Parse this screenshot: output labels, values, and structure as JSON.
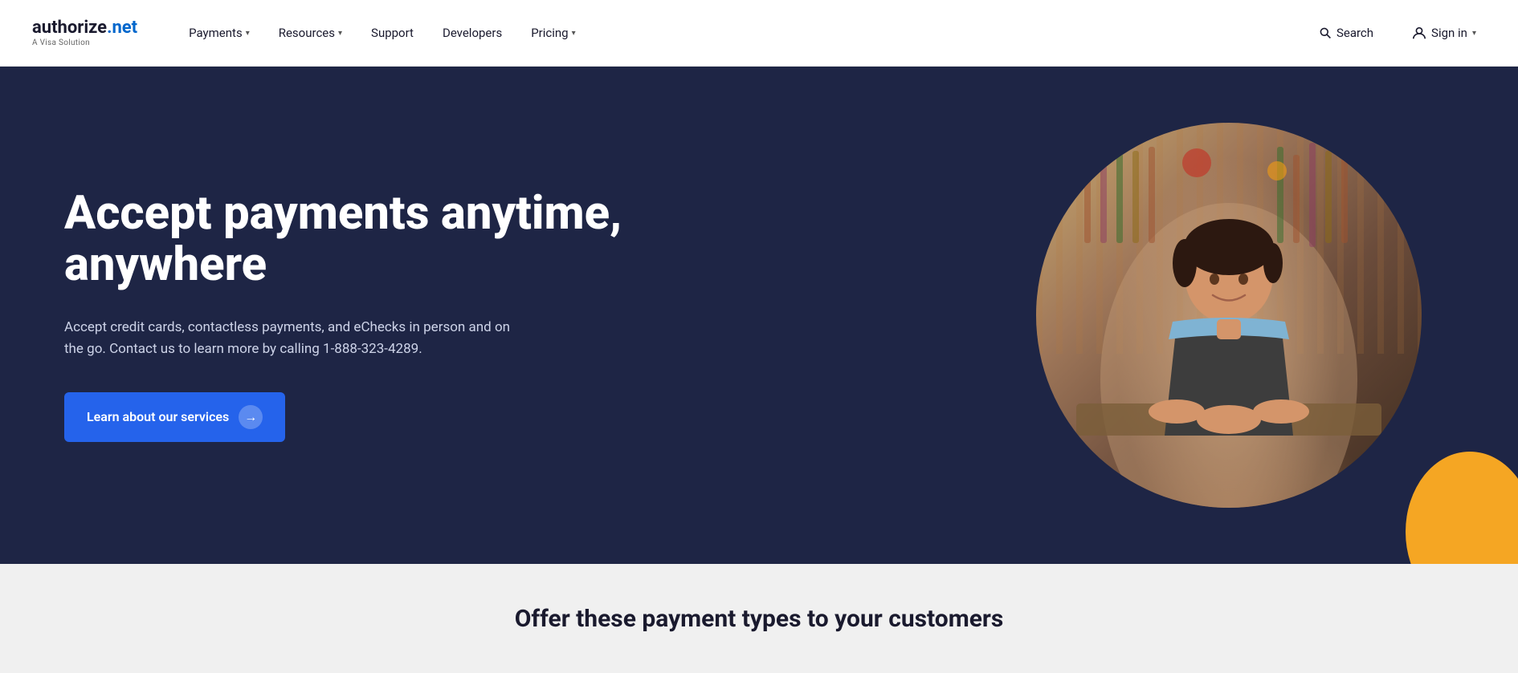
{
  "logo": {
    "brand": "authorize",
    "brand_dot": ".",
    "brand_net": "net",
    "tagline": "A Visa Solution"
  },
  "nav": {
    "items": [
      {
        "label": "Payments",
        "has_dropdown": true
      },
      {
        "label": "Resources",
        "has_dropdown": true
      },
      {
        "label": "Support",
        "has_dropdown": false
      },
      {
        "label": "Developers",
        "has_dropdown": false
      },
      {
        "label": "Pricing",
        "has_dropdown": true
      }
    ],
    "search_label": "Search",
    "signin_label": "Sign in"
  },
  "hero": {
    "title": "Accept payments anytime, anywhere",
    "description": "Accept credit cards, contactless payments, and eChecks in person and on the go. Contact us to learn more by calling 1-888-323-4289.",
    "cta_label": "Learn about our services"
  },
  "bottom": {
    "title": "Offer these payment types to your customers"
  }
}
